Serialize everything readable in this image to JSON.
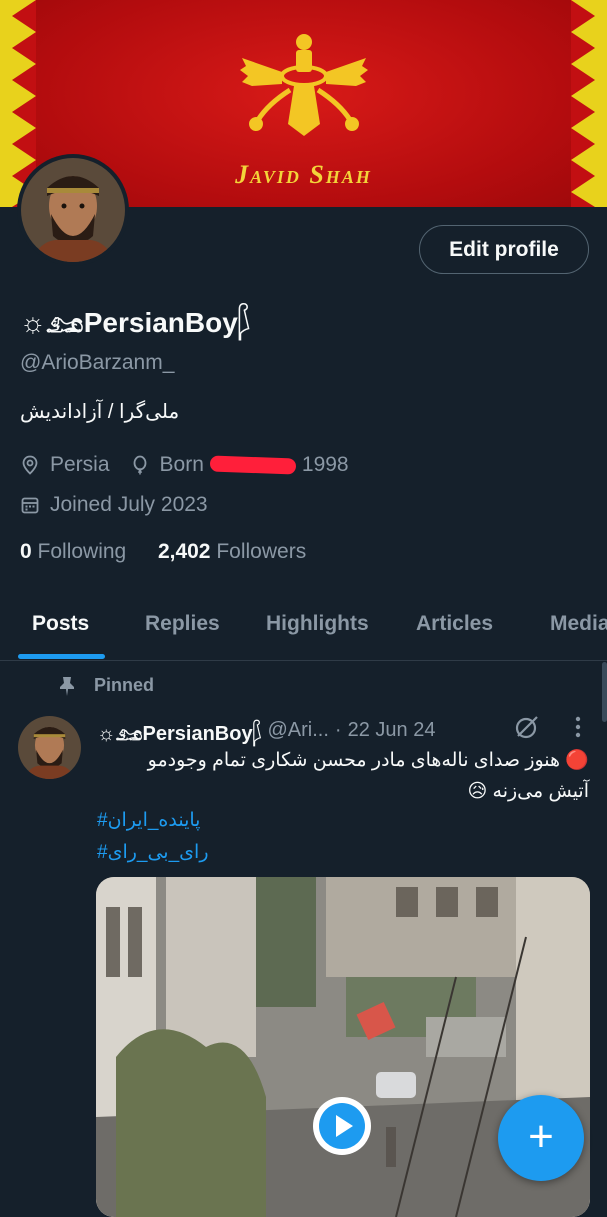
{
  "banner": {
    "title": "Javid Shah"
  },
  "profile": {
    "edit_label": "Edit profile",
    "display_name": "☼𓃭PersianBoy𓆄",
    "handle": "@ArioBarzanm_",
    "bio": "ملی‌گرا / آزاداندیش",
    "location": "Persia",
    "born_prefix": "Born",
    "born_year": "1998",
    "joined": "Joined July 2023",
    "following_count": "0",
    "following_label": "Following",
    "followers_count": "2,402",
    "followers_label": "Followers"
  },
  "tabs": [
    {
      "label": "Posts",
      "active": true
    },
    {
      "label": "Replies"
    },
    {
      "label": "Highlights"
    },
    {
      "label": "Articles"
    },
    {
      "label": "Media"
    }
  ],
  "post": {
    "pinned_label": "Pinned",
    "name": "☼𓃭PersianBoy𓆄",
    "handle": "@Ari...",
    "dot": "·",
    "date": "22 Jun 24",
    "text_line1": "🔴 هنوز صدای ناله‌های مادر محسن شکاری تمام وجودمو",
    "text_line2": "آتیش می‌زنه 😥",
    "hashtags": [
      "#پاینده_ایران",
      "#رای_بی_رای"
    ]
  },
  "fab_label": "+",
  "colors": {
    "background": "#15202b",
    "accent": "#1d9bf0",
    "muted": "#8b98a5",
    "banner_red": "#c20f12",
    "banner_gold": "#e8d21c"
  }
}
